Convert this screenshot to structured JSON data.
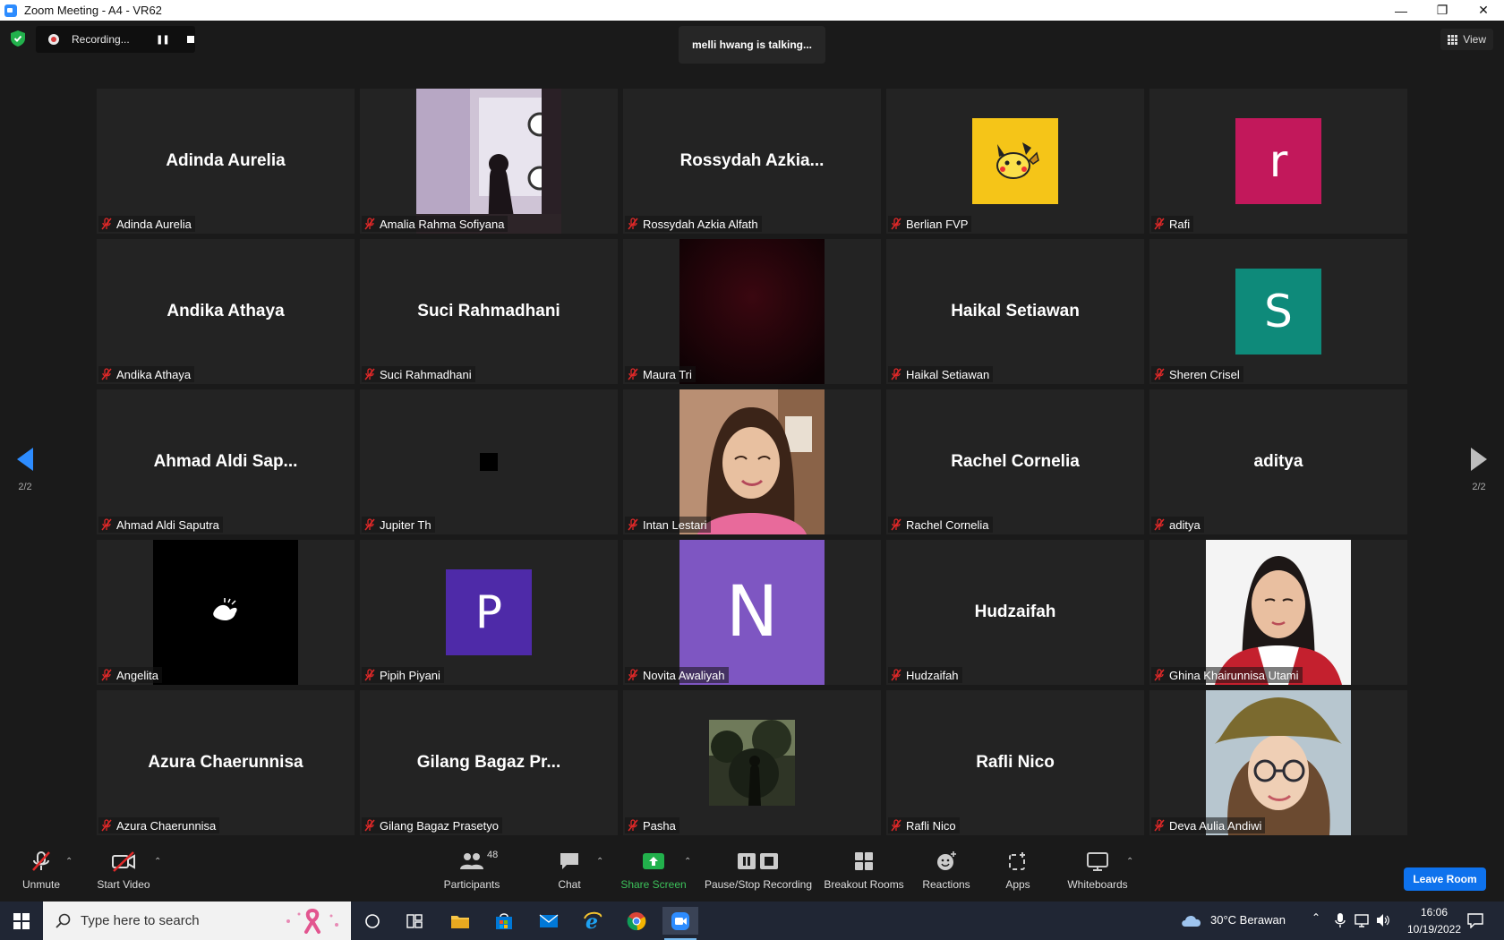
{
  "window": {
    "title": "Zoom Meeting - A4 - VR62",
    "minimize": "—",
    "restore": "❐",
    "close": "✕"
  },
  "recording": {
    "label": "Recording...",
    "pause_glyph": "❚❚"
  },
  "talking": {
    "text": "melli hwang is talking..."
  },
  "view": {
    "label": "View"
  },
  "pager": {
    "left": "2/2",
    "right": "2/2"
  },
  "accent": "#2d8cff",
  "participants": [
    {
      "name": "Adinda Aurelia",
      "display": "text",
      "center": "Adinda Aurelia"
    },
    {
      "name": "Amalia Rahma Sofiyana",
      "display": "video",
      "scene": "window-silhouette"
    },
    {
      "name": "Rossydah Azkia Alfath",
      "display": "text",
      "center": "Rossydah  Azkia..."
    },
    {
      "name": "Berlian FVP",
      "display": "avatar",
      "letter": "",
      "color": "#f5c518",
      "icon": "pikachu-icon"
    },
    {
      "name": "Rafi",
      "display": "avatar",
      "letter": "r",
      "color": "#c2185b"
    },
    {
      "name": "Andika Athaya",
      "display": "text",
      "center": "Andika Athaya"
    },
    {
      "name": "Suci Rahmadhani",
      "display": "text",
      "center": "Suci Rahmadhani"
    },
    {
      "name": "Maura Tri",
      "display": "video",
      "scene": "dark-red"
    },
    {
      "name": "Haikal Setiawan",
      "display": "text",
      "center": "Haikal Setiawan"
    },
    {
      "name": "Sheren Crisel",
      "display": "avatar",
      "letter": "S",
      "color": "#0e8a7a"
    },
    {
      "name": "Ahmad Aldi Saputra",
      "display": "text",
      "center": "Ahmad  Aldi  Sap..."
    },
    {
      "name": "Jupiter Th",
      "display": "tiny-square"
    },
    {
      "name": "Intan Lestari",
      "display": "video",
      "scene": "portrait-pink"
    },
    {
      "name": "Rachel Cornelia",
      "display": "text",
      "center": "Rachel Cornelia"
    },
    {
      "name": "aditya",
      "display": "text",
      "center": "aditya"
    },
    {
      "name": "Angelita",
      "display": "video",
      "scene": "black-bird"
    },
    {
      "name": "Pipih Piyani",
      "display": "avatar",
      "letter": "P",
      "color": "#4e2aa8"
    },
    {
      "name": "Novita Awaliyah",
      "display": "avatar-big",
      "letter": "N",
      "color": "#7e56c2"
    },
    {
      "name": "Hudzaifah",
      "display": "text",
      "center": "Hudzaifah"
    },
    {
      "name": "Ghina Khairunnisa Utami",
      "display": "video",
      "scene": "portrait-white"
    },
    {
      "name": "Azura Chaerunnisa",
      "display": "text",
      "center": "Azura Chaerunnisa"
    },
    {
      "name": "Gilang Bagaz Prasetyo",
      "display": "text",
      "center": "Gilang  Bagaz  Pr..."
    },
    {
      "name": "Pasha",
      "display": "small-photo",
      "scene": "forest"
    },
    {
      "name": "Rafli Nico",
      "display": "text",
      "center": "Rafli Nico"
    },
    {
      "name": "Deva Aulia Andiwi",
      "display": "video",
      "scene": "portrait-hat"
    }
  ],
  "toolbar": {
    "unmute": "Unmute",
    "start_video": "Start Video",
    "participants": "Participants",
    "participants_count": "48",
    "chat": "Chat",
    "share_screen": "Share Screen",
    "pause_stop_recording": "Pause/Stop Recording",
    "breakout_rooms": "Breakout Rooms",
    "reactions": "Reactions",
    "apps": "Apps",
    "whiteboards": "Whiteboards",
    "leave_room": "Leave Room"
  },
  "taskbar": {
    "search_placeholder": "Type here to search",
    "weather": "30°C  Berawan",
    "time": "16:06",
    "date": "10/19/2022"
  }
}
